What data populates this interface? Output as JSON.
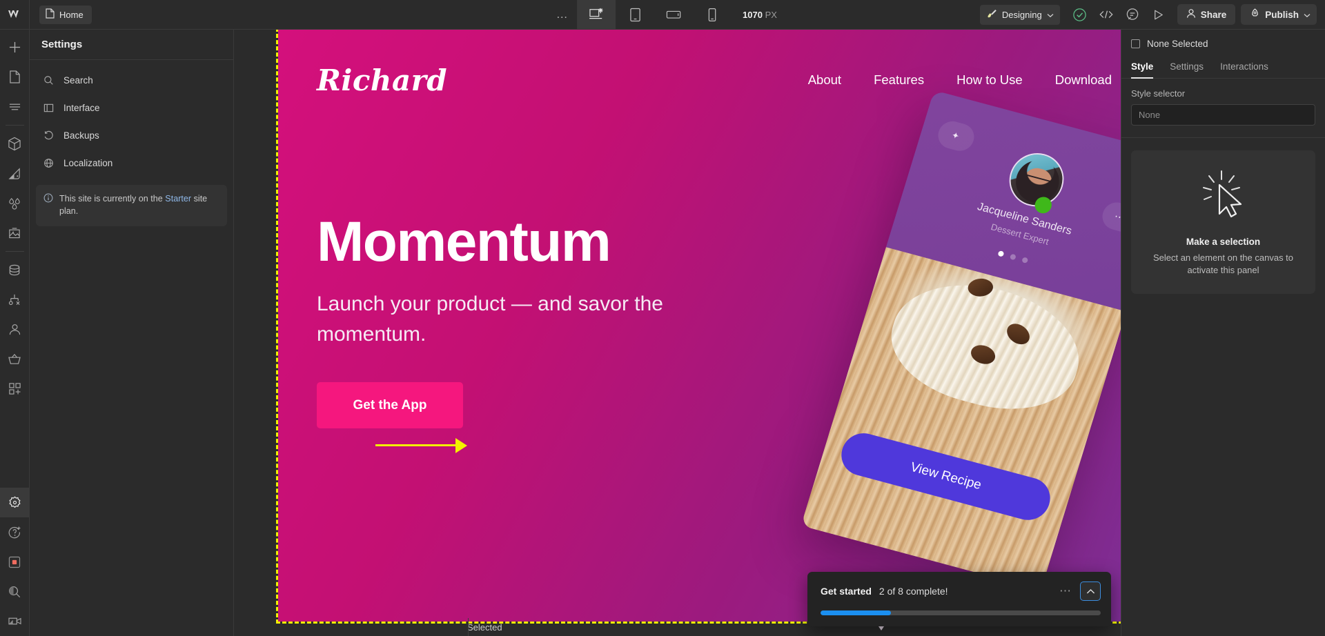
{
  "topbar": {
    "logo_icon": "webflow-logo-icon",
    "page_chip": {
      "icon": "page-icon",
      "label": "Home"
    },
    "more_dots": "…",
    "breakpoints": [
      {
        "name": "desktop",
        "icon": "desktop-breakpoint-icon",
        "active": true
      },
      {
        "name": "tablet",
        "icon": "tablet-breakpoint-icon",
        "active": false
      },
      {
        "name": "mobile-landscape",
        "icon": "mobile-landscape-icon",
        "active": false
      },
      {
        "name": "mobile-portrait",
        "icon": "mobile-portrait-icon",
        "active": false
      }
    ],
    "viewport_size": {
      "value": "1070",
      "unit": "PX"
    },
    "mode": {
      "icon": "brush-icon",
      "label": "Designing",
      "chevron": "chevron-down-icon"
    },
    "icons": [
      {
        "name": "audit-check-icon"
      },
      {
        "name": "code-icon"
      },
      {
        "name": "comment-icon"
      },
      {
        "name": "preview-play-icon"
      }
    ],
    "share": {
      "icon": "person-icon",
      "label": "Share"
    },
    "publish": {
      "icon": "rocket-icon",
      "label": "Publish",
      "chevron": "chevron-down-icon"
    }
  },
  "rail": {
    "top_items": [
      {
        "name": "add-elements",
        "icon": "plus-icon"
      },
      {
        "name": "pages",
        "icon": "page-icon"
      },
      {
        "name": "navigator",
        "icon": "navigator-icon"
      }
    ],
    "mid_items": [
      {
        "name": "components",
        "icon": "cube-icon"
      },
      {
        "name": "style-manager",
        "icon": "paint-swatch-icon"
      },
      {
        "name": "variables",
        "icon": "droplets-icon"
      },
      {
        "name": "assets",
        "icon": "image-icon"
      }
    ],
    "data_items": [
      {
        "name": "cms",
        "icon": "database-icon"
      },
      {
        "name": "logic",
        "icon": "logic-flow-icon"
      },
      {
        "name": "users",
        "icon": "user-icon"
      },
      {
        "name": "ecommerce",
        "icon": "basket-icon"
      },
      {
        "name": "apps",
        "icon": "apps-grid-icon"
      }
    ],
    "bottom_items": [
      {
        "name": "settings",
        "icon": "gear-icon",
        "active": true
      },
      {
        "name": "help",
        "icon": "question-plus-icon",
        "active": false
      },
      {
        "name": "record",
        "icon": "record-stop-icon",
        "active": false
      },
      {
        "name": "search",
        "icon": "search-icon",
        "active": false
      },
      {
        "name": "video",
        "icon": "video-camera-icon",
        "active": false
      }
    ]
  },
  "settings_panel": {
    "title": "Settings",
    "items": [
      {
        "label": "Search",
        "icon": "search-icon"
      },
      {
        "label": "Interface",
        "icon": "panel-layout-icon"
      },
      {
        "label": "Backups",
        "icon": "history-undo-icon"
      },
      {
        "label": "Localization",
        "icon": "globe-icon"
      }
    ],
    "notice": {
      "icon": "info-icon",
      "text_before": "This site is currently on the ",
      "link": "Starter",
      "text_after": " site plan."
    }
  },
  "style_panel": {
    "selection_label": "None Selected",
    "tabs": [
      {
        "label": "Style",
        "active": true
      },
      {
        "label": "Settings",
        "active": false
      },
      {
        "label": "Interactions",
        "active": false
      }
    ],
    "style_selector": {
      "label": "Style selector",
      "value": "None",
      "placeholder": "None"
    },
    "empty_state": {
      "icon": "cursor-click-icon",
      "title": "Make a selection",
      "subtitle": "Select an element on the canvas to activate this panel"
    }
  },
  "canvas": {
    "hero": {
      "brand": "Richard",
      "nav_links": [
        "About",
        "Features",
        "How to Use",
        "Download"
      ],
      "heading": "Momentum",
      "subheading": "Launch your product — and savor the momentum.",
      "cta_label": "Get the App",
      "cta_color": "#f5177e",
      "background_start": "#d4107c",
      "background_end": "#7b2f95"
    },
    "phone_card": {
      "star_icon": "star-icon",
      "menu_icon": "ellipsis-icon",
      "avatar_icon": "avatar",
      "status_icon": "online-status-dot",
      "name": "Jacqueline Sanders",
      "role": "Dessert Expert",
      "carousel_dots": 3,
      "carousel_active_index": 0,
      "button_label": "View Recipe",
      "button_color": "#4f38db"
    },
    "annotations": {
      "left_arrow": "yellow-arrow-right",
      "down_arrow": "white-arrow-down",
      "selection_outline": "yellow-dashed-outline"
    }
  },
  "get_started": {
    "title": "Get started",
    "count": "2 of 8 complete!",
    "menu_icon": "ellipsis-icon",
    "collapse_icon": "chevron-up-icon",
    "progress_percent": 25,
    "progress_color": "#1b8ff0"
  },
  "status_bar": {
    "text": "Selected"
  }
}
